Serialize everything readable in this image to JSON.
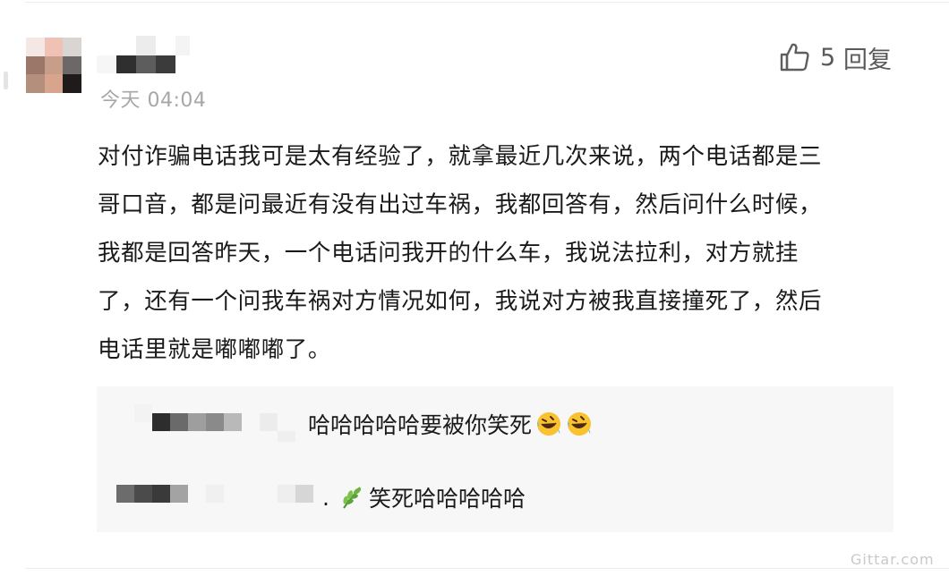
{
  "comment": {
    "timestamp": "今天 04:04",
    "likes": "5",
    "reply_label": "回复",
    "lines": [
      "对付诈骗电话我可是太有经验了，就拿最近几次来说，两个电话都是三",
      "哥口音，都是问最近有没有出过车祸，我都回答有，然后问什么时候，",
      "我都是回答昨天，一个电话问我开的什么车，我说法拉利，对方就挂",
      "了，还有一个问我车祸对方情况如何，我说对方被我直接撞死了，然后",
      "电话里就是嘟嘟嘟了。"
    ]
  },
  "replies": [
    {
      "text": "哈哈哈哈哈要被你笑死",
      "emoji": "rolling-on-floor-laughing-icon"
    },
    {
      "prefix": ".",
      "emoji": "herb-leaf-icon",
      "text": "笑死哈哈哈哈哈"
    }
  ],
  "watermark": "Gittar.com"
}
